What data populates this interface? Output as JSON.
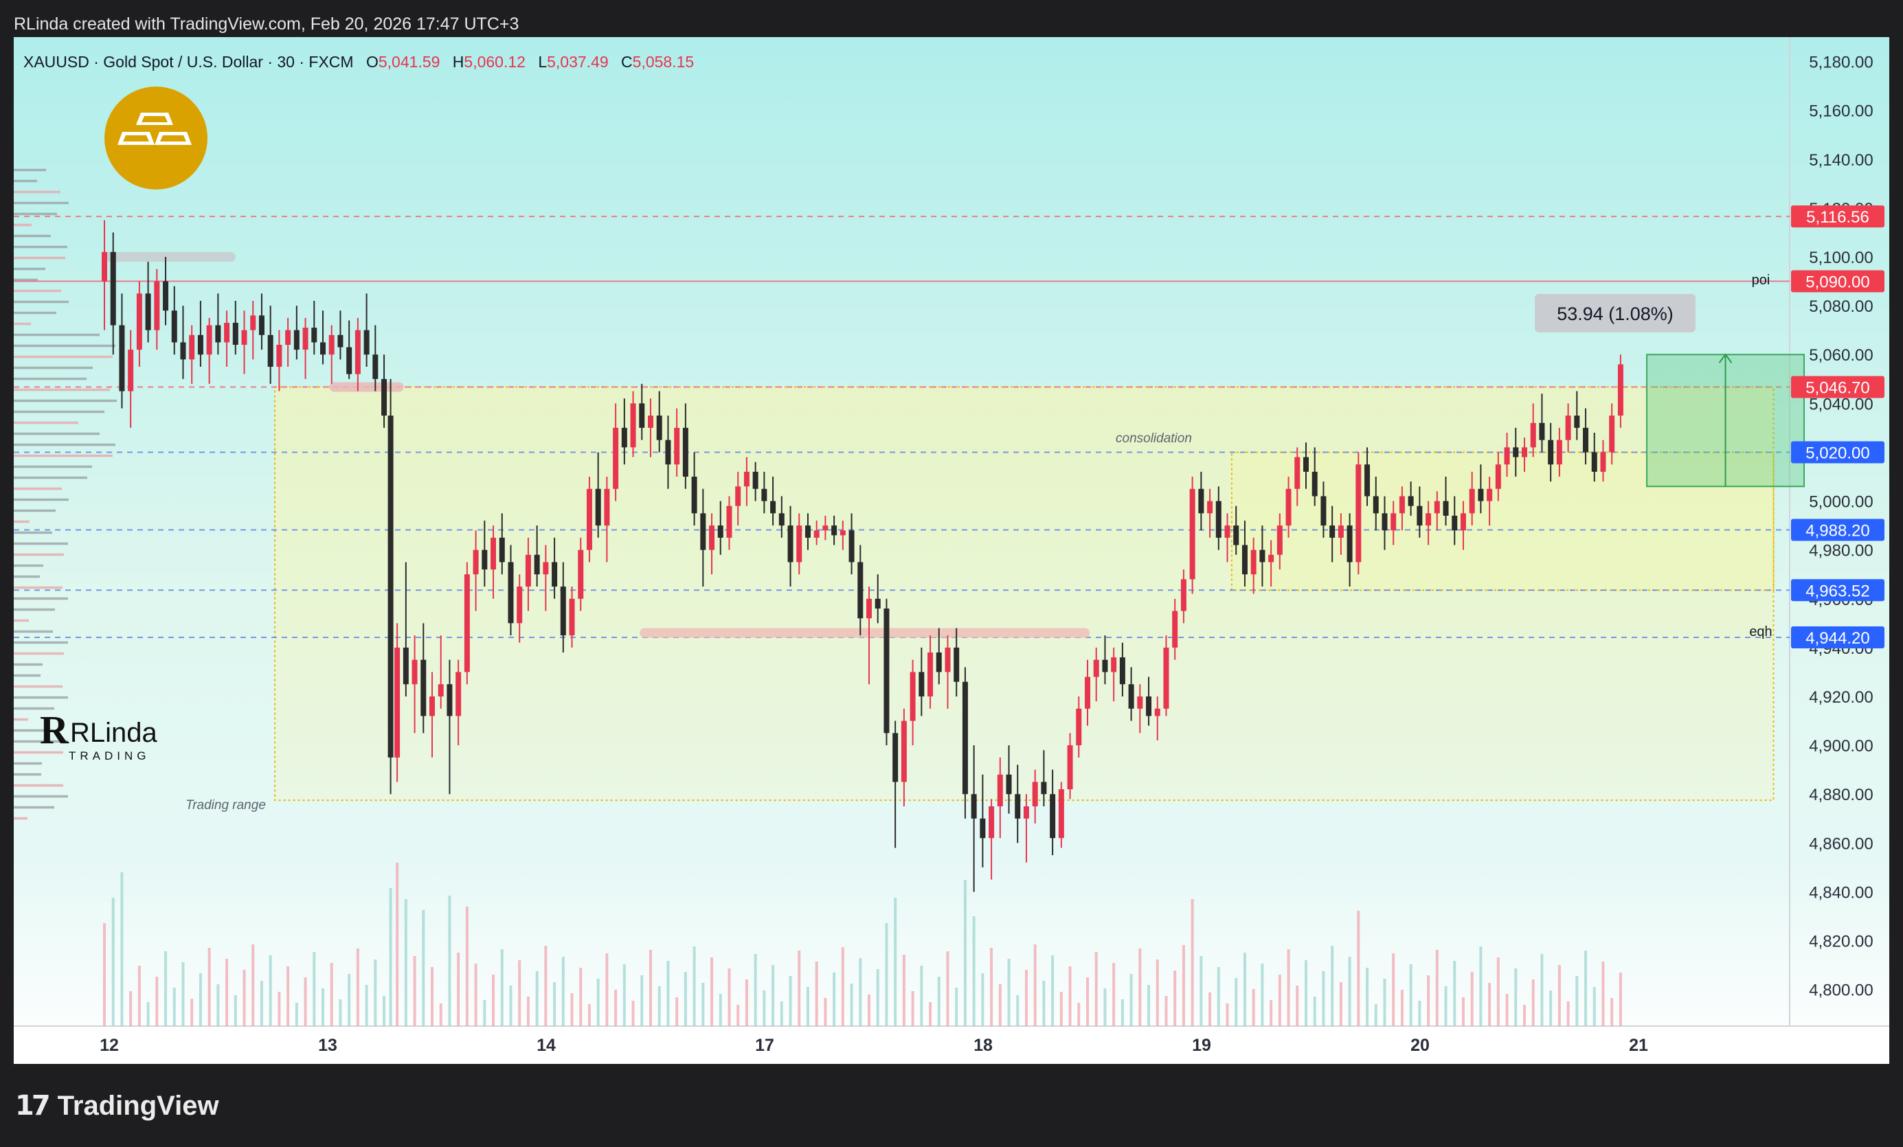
{
  "attribution": "RLinda created with TradingView.com, Feb 20, 2026 17:47 UTC+3",
  "footer_brand": "TradingView",
  "legend": {
    "symbol": "XAUUSD · Gold Spot / U.S. Dollar · 30 · FXCM",
    "o_label": "O",
    "o_value": "5,041.59",
    "h_label": "H",
    "h_value": "5,060.12",
    "l_label": "L",
    "l_value": "5,037.49",
    "c_label": "C",
    "c_value": "5,058.15"
  },
  "watermark": {
    "name": "RLinda",
    "sub": "TRADING"
  },
  "annotations": {
    "trading_range": "Trading range",
    "consolidation": "consolidation",
    "measure": "53.94 (1.08%)",
    "poi": "poi",
    "eqh": "eqh"
  },
  "colors": {
    "up": "#e8354f",
    "down": "#2b2b2b",
    "red_tag": "#f03e4e",
    "blue_tag": "#2a62ff",
    "grid_text": "#2a2e39",
    "accent_gold": "#d9a200"
  },
  "chart_data": {
    "type": "candlestick",
    "symbol": "XAUUSD",
    "timeframe": "30",
    "ylim": [
      4785,
      5190
    ],
    "y_ticks": [
      4800,
      4820,
      4840,
      4860,
      4880,
      4900,
      4920,
      4940,
      4960,
      4980,
      5000,
      5020,
      5040,
      5060,
      5080,
      5100,
      5120,
      5140,
      5160,
      5180
    ],
    "y_tick_labels": [
      "4,800.00",
      "4,820.00",
      "4,840.00",
      "4,860.00",
      "4,880.00",
      "4,900.00",
      "4,920.00",
      "4,940.00",
      "4,960.00",
      "4,980.00",
      "5,000.00",
      "5,020.00",
      "5,040.00",
      "5,060.00",
      "5,080.00",
      "5,100.00",
      "5,120.00",
      "5,140.00",
      "5,160.00",
      "5,180.00"
    ],
    "x_ticks": [
      "12",
      "13",
      "14",
      "17",
      "18",
      "19",
      "20",
      "21"
    ],
    "x_tick_day_index": [
      0.5,
      1.5,
      2.5,
      3.5,
      4.5,
      5.5,
      6.5,
      7.5
    ],
    "levels": [
      {
        "price": 5116.56,
        "label": "5,116.56",
        "kind": "red-dashed"
      },
      {
        "price": 5090.0,
        "label": "5,090.00",
        "kind": "red-solid",
        "note": "poi"
      },
      {
        "price": 5046.7,
        "label": "5,046.70",
        "kind": "red-dashed"
      },
      {
        "price": 5020.0,
        "label": "5,020.00",
        "kind": "blue-dashed"
      },
      {
        "price": 4988.2,
        "label": "4,988.20",
        "kind": "blue-dashed"
      },
      {
        "price": 4963.52,
        "label": "4,963.52",
        "kind": "blue-dashed"
      },
      {
        "price": 4944.2,
        "label": "4,944.20",
        "kind": "blue-dashed",
        "note": "eqh"
      }
    ],
    "zones": [
      {
        "name": "Trading range",
        "from_day": 0.78,
        "to_day": 7.64,
        "low": 4877.5,
        "high": 5046.7
      },
      {
        "name": "consolidation",
        "from_day": 5.16,
        "to_day": 7.64,
        "low": 4963.5,
        "high": 5020.0
      }
    ],
    "measure": {
      "from_day": 7.06,
      "to_day": 7.78,
      "low": 5006.0,
      "high": 5060.0,
      "label": "53.94 (1.08%)"
    },
    "candles": [
      [
        0.0,
        5090,
        5115,
        5070,
        5102
      ],
      [
        0.04,
        5102,
        5110,
        5060,
        5072
      ],
      [
        0.08,
        5072,
        5085,
        5038,
        5045
      ],
      [
        0.12,
        5045,
        5070,
        5030,
        5062
      ],
      [
        0.16,
        5062,
        5090,
        5055,
        5085
      ],
      [
        0.2,
        5085,
        5098,
        5065,
        5070
      ],
      [
        0.24,
        5070,
        5095,
        5062,
        5090
      ],
      [
        0.28,
        5090,
        5100,
        5072,
        5078
      ],
      [
        0.32,
        5078,
        5088,
        5060,
        5065
      ],
      [
        0.36,
        5065,
        5080,
        5050,
        5058
      ],
      [
        0.4,
        5058,
        5072,
        5048,
        5068
      ],
      [
        0.44,
        5068,
        5082,
        5055,
        5060
      ],
      [
        0.48,
        5060,
        5075,
        5048,
        5072
      ],
      [
        0.52,
        5072,
        5085,
        5060,
        5065
      ],
      [
        0.56,
        5065,
        5078,
        5055,
        5073
      ],
      [
        0.6,
        5073,
        5082,
        5060,
        5064
      ],
      [
        0.64,
        5064,
        5078,
        5052,
        5070
      ],
      [
        0.68,
        5070,
        5082,
        5058,
        5076
      ],
      [
        0.72,
        5076,
        5085,
        5062,
        5068
      ],
      [
        0.76,
        5068,
        5080,
        5048,
        5055
      ],
      [
        0.8,
        5055,
        5070,
        5045,
        5064
      ],
      [
        0.84,
        5064,
        5075,
        5055,
        5070
      ],
      [
        0.88,
        5070,
        5080,
        5058,
        5062
      ],
      [
        0.92,
        5062,
        5075,
        5050,
        5071
      ],
      [
        0.96,
        5071,
        5082,
        5060,
        5065
      ],
      [
        1.0,
        5065,
        5078,
        5056,
        5060
      ],
      [
        1.04,
        5060,
        5072,
        5048,
        5068
      ],
      [
        1.08,
        5068,
        5078,
        5058,
        5063
      ],
      [
        1.12,
        5063,
        5074,
        5050,
        5052
      ],
      [
        1.16,
        5052,
        5075,
        5045,
        5070
      ],
      [
        1.2,
        5070,
        5085,
        5055,
        5060
      ],
      [
        1.24,
        5060,
        5072,
        5045,
        5050
      ],
      [
        1.28,
        5050,
        5060,
        5030,
        5035
      ],
      [
        1.31,
        5035,
        5050,
        4880,
        4895
      ],
      [
        1.34,
        4895,
        4950,
        4885,
        4940
      ],
      [
        1.38,
        4940,
        4975,
        4920,
        4925
      ],
      [
        1.42,
        4925,
        4945,
        4905,
        4935
      ],
      [
        1.46,
        4935,
        4950,
        4905,
        4912
      ],
      [
        1.5,
        4912,
        4930,
        4895,
        4920
      ],
      [
        1.54,
        4920,
        4945,
        4915,
        4925
      ],
      [
        1.58,
        4925,
        4935,
        4880,
        4912
      ],
      [
        1.62,
        4912,
        4935,
        4900,
        4930
      ],
      [
        1.66,
        4930,
        4975,
        4925,
        4970
      ],
      [
        1.7,
        4970,
        4988,
        4955,
        4980
      ],
      [
        1.74,
        4980,
        4992,
        4965,
        4972
      ],
      [
        1.78,
        4972,
        4990,
        4960,
        4985
      ],
      [
        1.82,
        4985,
        4995,
        4970,
        4975
      ],
      [
        1.86,
        4975,
        4982,
        4945,
        4950
      ],
      [
        1.9,
        4950,
        4970,
        4942,
        4965
      ],
      [
        1.94,
        4965,
        4985,
        4955,
        4978
      ],
      [
        1.98,
        4978,
        4990,
        4965,
        4970
      ],
      [
        2.02,
        4970,
        4982,
        4955,
        4975
      ],
      [
        2.06,
        4975,
        4985,
        4960,
        4965
      ],
      [
        2.1,
        4965,
        4975,
        4938,
        4945
      ],
      [
        2.14,
        4945,
        4965,
        4940,
        4960
      ],
      [
        2.18,
        4960,
        4985,
        4955,
        4980
      ],
      [
        2.22,
        4980,
        5010,
        4975,
        5005
      ],
      [
        2.26,
        5005,
        5020,
        4985,
        4990
      ],
      [
        2.3,
        4990,
        5010,
        4975,
        5005
      ],
      [
        2.34,
        5005,
        5040,
        5000,
        5030
      ],
      [
        2.38,
        5030,
        5042,
        5015,
        5022
      ],
      [
        2.42,
        5022,
        5045,
        5018,
        5040
      ],
      [
        2.46,
        5040,
        5048,
        5025,
        5030
      ],
      [
        2.5,
        5030,
        5042,
        5018,
        5035
      ],
      [
        2.54,
        5035,
        5045,
        5020,
        5025
      ],
      [
        2.58,
        5025,
        5035,
        5005,
        5015
      ],
      [
        2.62,
        5015,
        5038,
        5010,
        5030
      ],
      [
        2.66,
        5030,
        5040,
        5005,
        5010
      ],
      [
        2.7,
        5010,
        5020,
        4990,
        4995
      ],
      [
        2.74,
        4995,
        5005,
        4965,
        4980
      ],
      [
        2.78,
        4980,
        4995,
        4970,
        4990
      ],
      [
        2.82,
        4990,
        5000,
        4978,
        4985
      ],
      [
        2.86,
        4985,
        5002,
        4980,
        4998
      ],
      [
        2.9,
        4998,
        5012,
        4990,
        5006
      ],
      [
        2.94,
        5006,
        5018,
        4998,
        5012
      ],
      [
        2.98,
        5012,
        5016,
        5000,
        5005
      ],
      [
        3.02,
        5005,
        5012,
        4995,
        5000
      ],
      [
        3.06,
        5000,
        5010,
        4990,
        4995
      ],
      [
        3.1,
        4995,
        5002,
        4985,
        4990
      ],
      [
        3.14,
        4990,
        4998,
        4965,
        4975
      ],
      [
        3.18,
        4975,
        4995,
        4970,
        4990
      ],
      [
        3.22,
        4990,
        4995,
        4980,
        4985
      ],
      [
        3.26,
        4985,
        4992,
        4982,
        4988
      ],
      [
        3.3,
        4988,
        4994,
        4984,
        4990
      ],
      [
        3.34,
        4990,
        4994,
        4982,
        4986
      ],
      [
        3.38,
        4986,
        4992,
        4980,
        4988
      ],
      [
        3.42,
        4988,
        4995,
        4970,
        4975
      ],
      [
        3.46,
        4975,
        4982,
        4945,
        4952
      ],
      [
        3.5,
        4952,
        4965,
        4925,
        4960
      ],
      [
        3.54,
        4960,
        4970,
        4950,
        4956
      ],
      [
        3.58,
        4956,
        4960,
        4900,
        4905
      ],
      [
        3.62,
        4905,
        4910,
        4858,
        4885
      ],
      [
        3.66,
        4885,
        4915,
        4875,
        4910
      ],
      [
        3.7,
        4910,
        4935,
        4900,
        4930
      ],
      [
        3.74,
        4930,
        4940,
        4912,
        4920
      ],
      [
        3.78,
        4920,
        4945,
        4915,
        4938
      ],
      [
        3.82,
        4938,
        4948,
        4925,
        4930
      ],
      [
        3.86,
        4930,
        4945,
        4915,
        4940
      ],
      [
        3.9,
        4940,
        4948,
        4920,
        4926
      ],
      [
        3.94,
        4926,
        4932,
        4870,
        4880
      ],
      [
        3.98,
        4880,
        4900,
        4840,
        4870
      ],
      [
        4.02,
        4870,
        4888,
        4850,
        4862
      ],
      [
        4.06,
        4862,
        4878,
        4845,
        4875
      ],
      [
        4.1,
        4875,
        4895,
        4862,
        4888
      ],
      [
        4.14,
        4888,
        4900,
        4872,
        4880
      ],
      [
        4.18,
        4880,
        4892,
        4860,
        4870
      ],
      [
        4.22,
        4870,
        4880,
        4852,
        4875
      ],
      [
        4.26,
        4875,
        4890,
        4868,
        4885
      ],
      [
        4.3,
        4885,
        4898,
        4875,
        4880
      ],
      [
        4.34,
        4880,
        4890,
        4855,
        4862
      ],
      [
        4.38,
        4862,
        4885,
        4858,
        4882
      ],
      [
        4.42,
        4882,
        4905,
        4878,
        4900
      ],
      [
        4.46,
        4900,
        4920,
        4895,
        4915
      ],
      [
        4.5,
        4915,
        4935,
        4908,
        4928
      ],
      [
        4.54,
        4928,
        4940,
        4918,
        4935
      ],
      [
        4.58,
        4935,
        4945,
        4925,
        4930
      ],
      [
        4.62,
        4930,
        4940,
        4918,
        4936
      ],
      [
        4.66,
        4936,
        4942,
        4920,
        4925
      ],
      [
        4.7,
        4925,
        4932,
        4910,
        4915
      ],
      [
        4.74,
        4915,
        4925,
        4905,
        4920
      ],
      [
        4.78,
        4920,
        4928,
        4908,
        4912
      ],
      [
        4.82,
        4912,
        4920,
        4902,
        4915
      ],
      [
        4.86,
        4915,
        4945,
        4912,
        4940
      ],
      [
        4.9,
        4940,
        4960,
        4935,
        4955
      ],
      [
        4.94,
        4955,
        4972,
        4950,
        4968
      ],
      [
        4.98,
        4968,
        5010,
        4962,
        5005
      ],
      [
        5.02,
        5005,
        5012,
        4988,
        4995
      ],
      [
        5.06,
        4995,
        5005,
        4985,
        5000
      ],
      [
        5.1,
        5000,
        5006,
        4980,
        4985
      ],
      [
        5.14,
        4985,
        4995,
        4975,
        4990
      ],
      [
        5.18,
        4990,
        4998,
        4978,
        4982
      ],
      [
        5.22,
        4982,
        4992,
        4965,
        4970
      ],
      [
        5.26,
        4970,
        4985,
        4962,
        4980
      ],
      [
        5.3,
        4980,
        4990,
        4965,
        4975
      ],
      [
        5.34,
        4975,
        4984,
        4965,
        4978
      ],
      [
        5.38,
        4978,
        4995,
        4972,
        4990
      ],
      [
        5.42,
        4990,
        5010,
        4985,
        5005
      ],
      [
        5.46,
        5005,
        5022,
        4998,
        5018
      ],
      [
        5.5,
        5018,
        5024,
        5005,
        5012
      ],
      [
        5.54,
        5012,
        5022,
        4998,
        5002
      ],
      [
        5.58,
        5002,
        5008,
        4985,
        4990
      ],
      [
        5.62,
        4990,
        4998,
        4975,
        4985
      ],
      [
        5.66,
        4985,
        4995,
        4978,
        4990
      ],
      [
        5.7,
        4990,
        4995,
        4965,
        4975
      ],
      [
        5.74,
        4975,
        5020,
        4970,
        5015
      ],
      [
        5.78,
        5015,
        5022,
        4998,
        5002
      ],
      [
        5.82,
        5002,
        5010,
        4988,
        4995
      ],
      [
        5.86,
        4995,
        5002,
        4980,
        4988
      ],
      [
        5.9,
        4988,
        5000,
        4982,
        4995
      ],
      [
        5.94,
        4995,
        5006,
        4988,
        5002
      ],
      [
        5.98,
        5002,
        5008,
        4994,
        4998
      ],
      [
        6.02,
        4998,
        5006,
        4985,
        4990
      ],
      [
        6.06,
        4990,
        5000,
        4982,
        4995
      ],
      [
        6.1,
        4995,
        5004,
        4988,
        5000
      ],
      [
        6.14,
        5000,
        5010,
        4990,
        4994
      ],
      [
        6.18,
        4994,
        5002,
        4982,
        4988
      ],
      [
        6.22,
        4988,
        5000,
        4980,
        4995
      ],
      [
        6.26,
        4995,
        5012,
        4990,
        5005
      ],
      [
        6.3,
        5005,
        5015,
        4995,
        5000
      ],
      [
        6.34,
        5000,
        5010,
        4990,
        5005
      ],
      [
        6.38,
        5005,
        5020,
        5000,
        5015
      ],
      [
        6.42,
        5015,
        5028,
        5010,
        5022
      ],
      [
        6.46,
        5022,
        5030,
        5010,
        5018
      ],
      [
        6.5,
        5018,
        5026,
        5012,
        5022
      ],
      [
        6.54,
        5022,
        5040,
        5018,
        5032
      ],
      [
        6.58,
        5032,
        5044,
        5020,
        5025
      ],
      [
        6.62,
        5025,
        5032,
        5008,
        5015
      ],
      [
        6.66,
        5015,
        5030,
        5010,
        5025
      ],
      [
        6.7,
        5025,
        5040,
        5020,
        5035
      ],
      [
        6.74,
        5035,
        5045,
        5025,
        5030
      ],
      [
        6.78,
        5030,
        5038,
        5015,
        5020
      ],
      [
        6.82,
        5020,
        5028,
        5008,
        5012
      ],
      [
        6.86,
        5012,
        5025,
        5008,
        5020
      ],
      [
        6.9,
        5020,
        5040,
        5015,
        5035
      ],
      [
        6.94,
        5035,
        5060,
        5030,
        5056
      ]
    ]
  }
}
